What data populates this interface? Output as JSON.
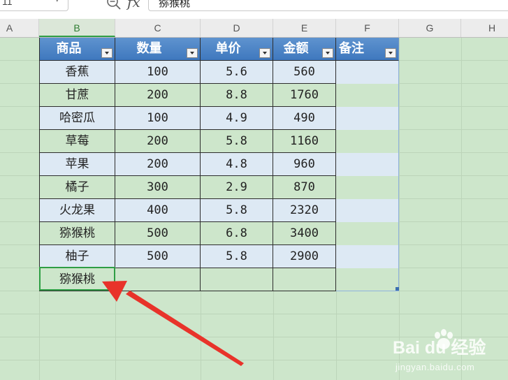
{
  "formula_bar": {
    "name_box": "11",
    "fx_label": "fx",
    "formula": "猕猴桃"
  },
  "columns": [
    "A",
    "B",
    "C",
    "D",
    "E",
    "F",
    "G",
    "H"
  ],
  "selected_column": "B",
  "table": {
    "headers": [
      "商品",
      "数量",
      "单价",
      "金额",
      "备注"
    ],
    "rows": [
      [
        "香蕉",
        "100",
        "5.6",
        "560",
        ""
      ],
      [
        "甘蔗",
        "200",
        "8.8",
        "1760",
        ""
      ],
      [
        "哈密瓜",
        "100",
        "4.9",
        "490",
        ""
      ],
      [
        "草莓",
        "200",
        "5.8",
        "1160",
        ""
      ],
      [
        "苹果",
        "200",
        "4.8",
        "960",
        ""
      ],
      [
        "橘子",
        "300",
        "2.9",
        "870",
        ""
      ],
      [
        "火龙果",
        "400",
        "5.8",
        "2320",
        ""
      ],
      [
        "猕猴桃",
        "500",
        "6.8",
        "3400",
        ""
      ],
      [
        "柚子",
        "500",
        "5.8",
        "2900",
        ""
      ]
    ],
    "new_row": [
      "猕猴桃",
      "",
      "",
      "",
      ""
    ]
  },
  "colors": {
    "sheet_background": "#cde6cb",
    "header_fill": "#4a82c4",
    "band_fill": "#dde9f4",
    "selection": "#2e9e44",
    "annotation_arrow": "#e8332a"
  },
  "watermark": {
    "main": "Bai du 经验",
    "sub": "jingyan.baidu.com"
  }
}
